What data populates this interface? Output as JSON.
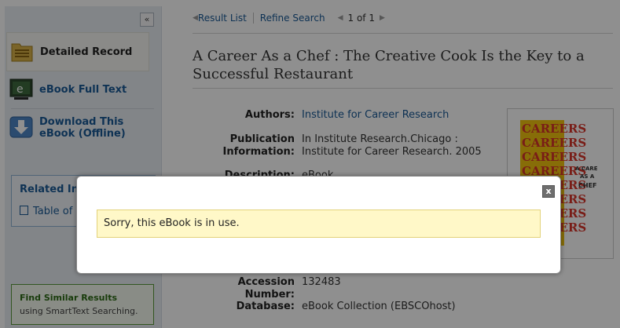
{
  "sidebar": {
    "collapse_label": "«",
    "items": [
      {
        "label": "Detailed Record"
      },
      {
        "label": "eBook Full Text"
      },
      {
        "label": "Download This eBook (Offline)"
      }
    ],
    "related": {
      "title": "Related Information",
      "toc": "Table of Contents"
    },
    "similar": {
      "title": "Find Similar Results",
      "subtitle": "using SmartText Searching."
    }
  },
  "nav": {
    "result_list": "Result List",
    "refine_search": "Refine Search",
    "page": "1 of 1"
  },
  "record": {
    "title": "A Career As a Chef : The Creative Cook Is the Key to a Successful Restaurant",
    "fields": [
      {
        "label": "Authors:",
        "value": "Institute for Career Research"
      },
      {
        "label": "Publication Information:",
        "value": "In Institute Research.Chicago : Institute for Career Research. 2005"
      },
      {
        "label": "Description:",
        "value": "eBook"
      },
      {
        "label": "Accession Number:",
        "value": "132483"
      },
      {
        "label": "Database:",
        "value": "eBook Collection (EBSCOhost)"
      }
    ],
    "cover": {
      "word": "CAREERS",
      "caption_lines": [
        "A CAREER",
        "AS A",
        "CHEF"
      ]
    }
  },
  "modal": {
    "close_label": "x",
    "message": "Sorry, this eBook is in use."
  },
  "colors": {
    "link": "#1a5a96",
    "overlay": "#000000",
    "message_bg": "#fff8c8"
  }
}
